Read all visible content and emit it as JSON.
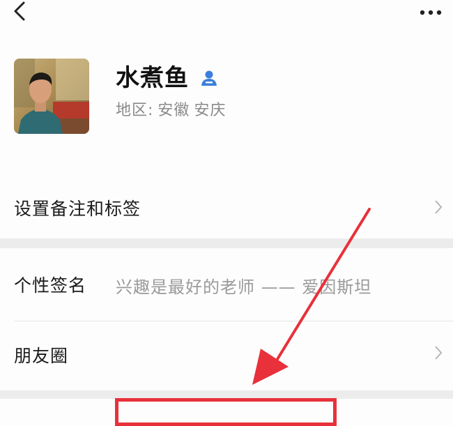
{
  "topbar": {
    "back_icon": "chevron-left-icon",
    "more_icon": "more-dots-icon"
  },
  "profile": {
    "name": "水煮鱼",
    "verified_icon": "contact-person-icon",
    "region_label": "地区:",
    "region_province": "安徽",
    "region_city": "安庆"
  },
  "rows": {
    "remark_label": "设置备注和标签",
    "signature_label": "个性签名",
    "signature_value": "兴趣是最好的老师 —— 爱因斯坦",
    "moments_label": "朋友圈"
  },
  "colors": {
    "annotation": "#e8313a",
    "contact_icon": "#3b7fdc",
    "section_gap": "#ececec"
  }
}
